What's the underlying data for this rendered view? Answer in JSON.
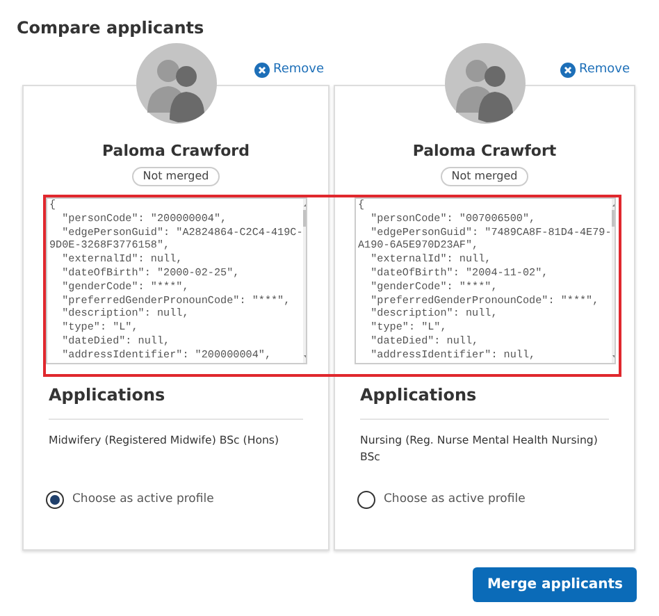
{
  "title": "Compare applicants",
  "applicants": [
    {
      "remove_label": "Remove",
      "name": "Paloma Crawford",
      "status": "Not merged",
      "record_lines": [
        "{",
        "  \"personCode\": \"200000004\",",
        "  \"edgePersonGuid\": \"A2824864-C2C4-419C-",
        "9D0E-3268F3776158\",",
        "  \"externalId\": null,",
        "  \"dateOfBirth\": \"2000-02-25\",",
        "  \"genderCode\": \"***\",",
        "  \"preferredGenderPronounCode\": \"***\",",
        "  \"description\": null,",
        "  \"type\": \"L\",",
        "  \"dateDied\": null,",
        "  \"addressIdentifier\": \"200000004\","
      ],
      "applications_heading": "Applications",
      "applications": [
        "Midwifery (Registered Midwife) BSc (Hons)"
      ],
      "choice_label": "Choose as active profile",
      "selected": true
    },
    {
      "remove_label": "Remove",
      "name": "Paloma Crawfort",
      "status": "Not merged",
      "record_lines": [
        "{",
        "  \"personCode\": \"007006500\",",
        "  \"edgePersonGuid\": \"7489CA8F-81D4-4E79-",
        "A190-6A5E970D23AF\",",
        "  \"externalId\": null,",
        "  \"dateOfBirth\": \"2004-11-02\",",
        "  \"genderCode\": \"***\",",
        "  \"preferredGenderPronounCode\": \"***\",",
        "  \"description\": null,",
        "  \"type\": \"L\",",
        "  \"dateDied\": null,",
        "  \"addressIdentifier\": null,"
      ],
      "applications_heading": "Applications",
      "applications": [
        "Nursing (Reg. Nurse Mental Health Nursing) BSc"
      ],
      "choice_label": "Choose as active profile",
      "selected": false
    }
  ],
  "merge_button": "Merge applicants"
}
